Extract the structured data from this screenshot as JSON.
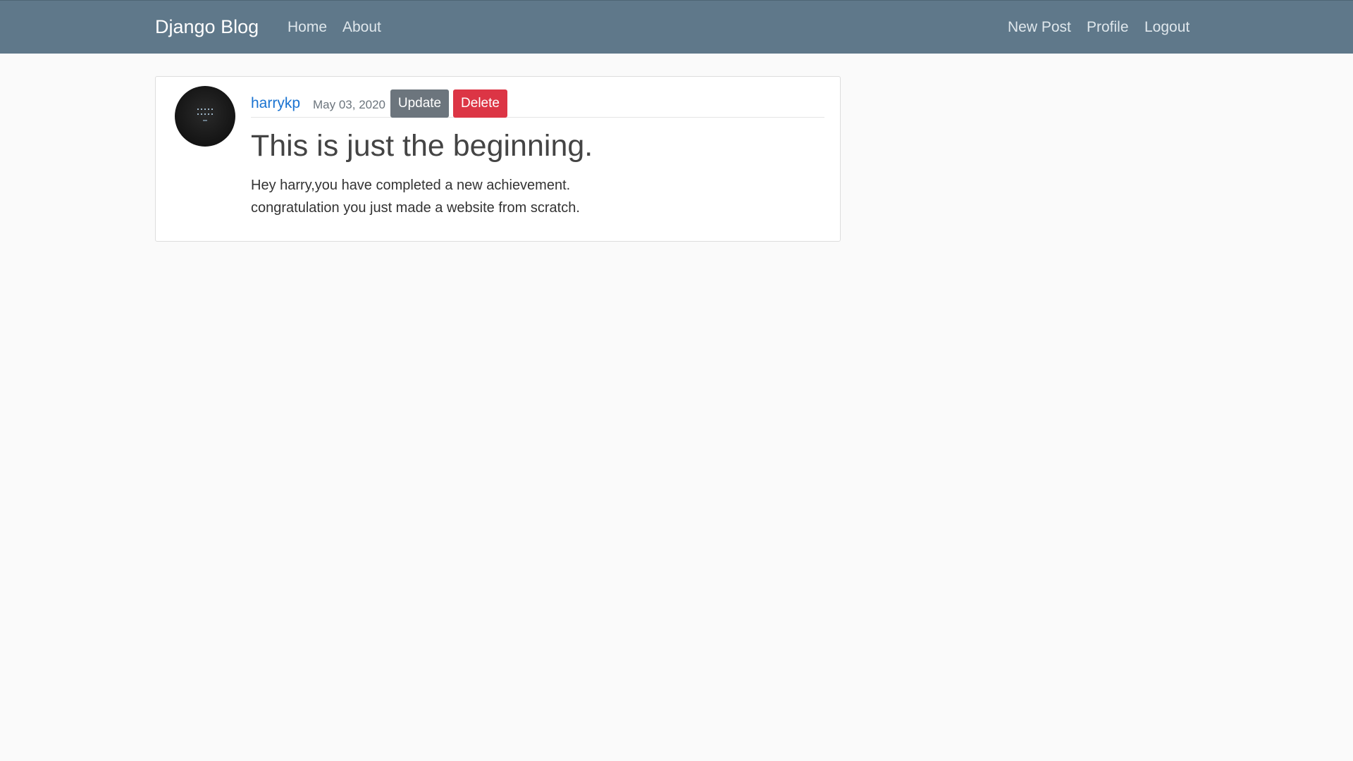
{
  "navbar": {
    "brand": "Django Blog",
    "left_links": [
      "Home",
      "About"
    ],
    "right_links": [
      "New Post",
      "Profile",
      "Logout"
    ]
  },
  "post": {
    "author": "harrykp",
    "date": "May 03, 2020",
    "update_label": "Update",
    "delete_label": "Delete",
    "title": "This is just the beginning.",
    "content": "Hey harry,you have completed a new achievement.\ncongratulation you just made a website from scratch."
  },
  "colors": {
    "navbar_bg": "#5f788a",
    "author_link": "#1a73d1",
    "update_button": "#6c757d",
    "delete_button": "#dc3545"
  }
}
